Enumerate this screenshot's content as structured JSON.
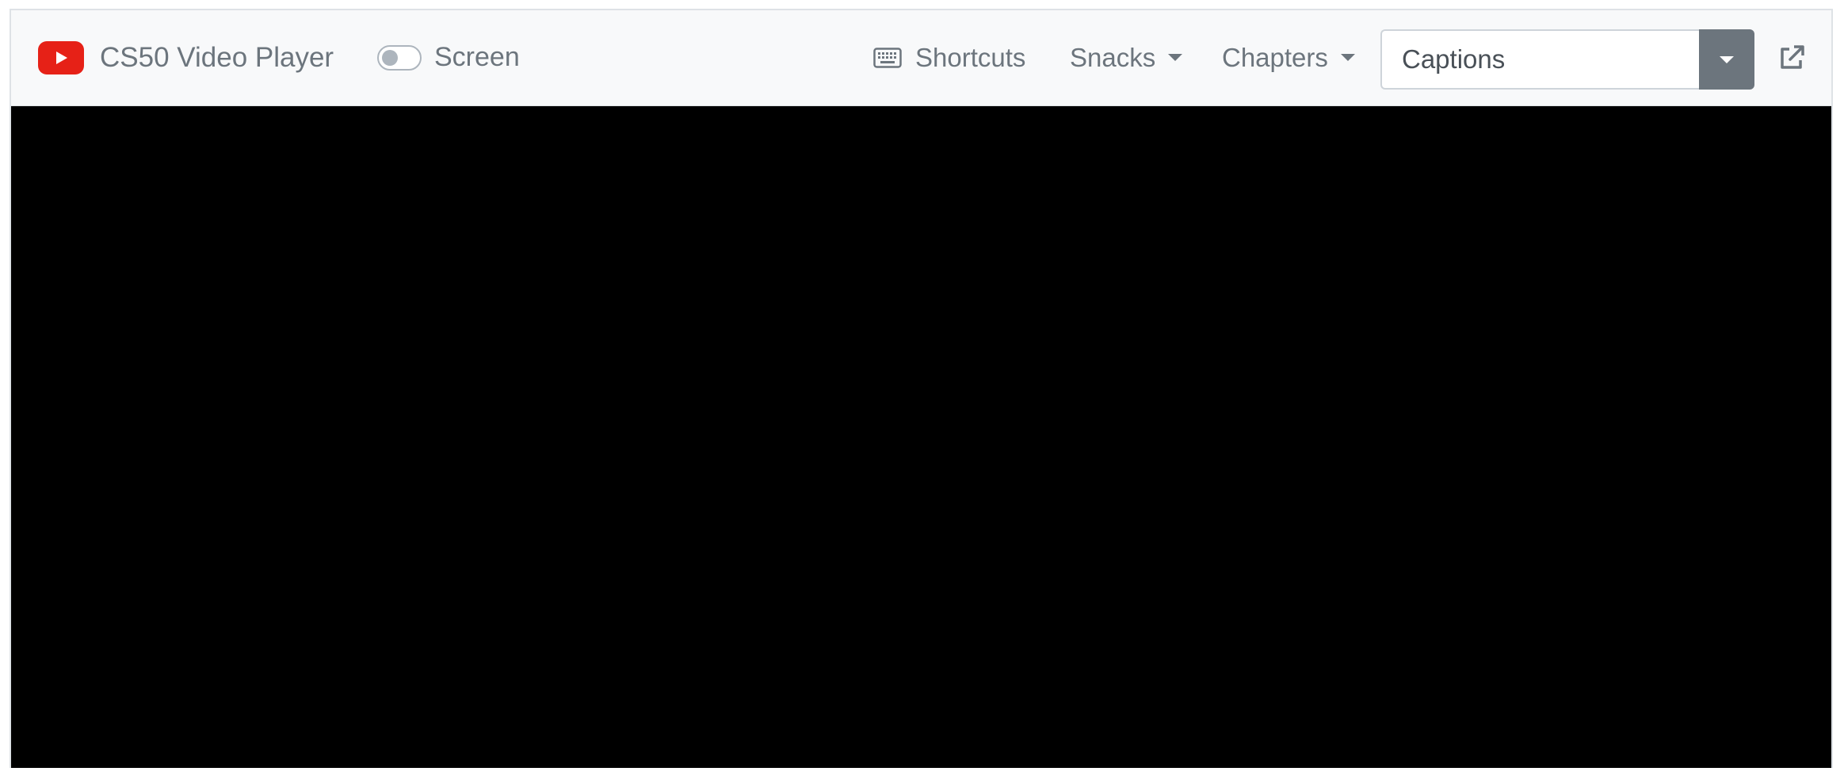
{
  "header": {
    "brand": {
      "logo_icon": "youtube-play-icon",
      "title": "CS50 Video Player"
    },
    "screen_toggle": {
      "label": "Screen",
      "checked": false
    },
    "shortcuts": {
      "icon": "keyboard-icon",
      "label": "Shortcuts"
    },
    "snacks": {
      "label": "Snacks"
    },
    "chapters": {
      "label": "Chapters"
    },
    "captions": {
      "selected": "Captions"
    },
    "popout": {
      "icon": "external-link-icon"
    }
  },
  "colors": {
    "brand_red": "#e62117",
    "muted_text": "#6c757d",
    "navbar_bg": "#f8f9fa",
    "video_bg": "#000000"
  }
}
